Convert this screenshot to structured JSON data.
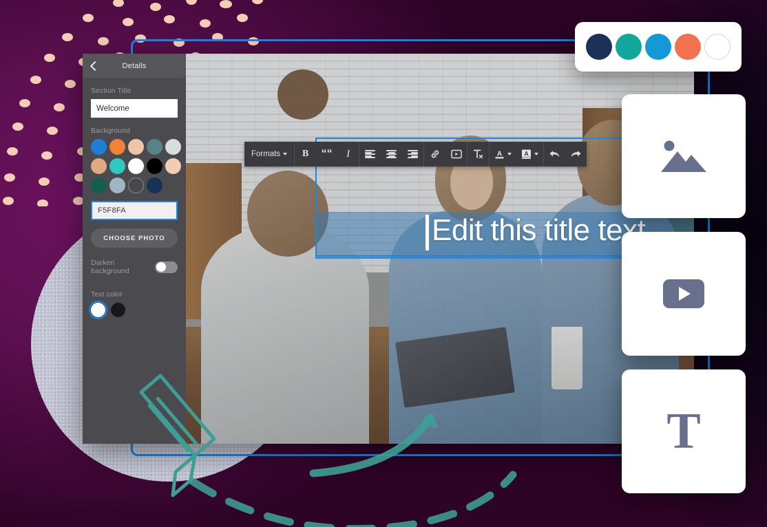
{
  "window": {
    "sidebar": {
      "header_title": "Details",
      "back_icon": "chevron-left-icon",
      "section_title_label": "Section Title",
      "section_title_value": "Welcome",
      "section_title_placeholder": "Section Title",
      "background_label": "Background",
      "background_swatches": [
        {
          "name": "blue",
          "hex": "#1f7fd6"
        },
        {
          "name": "orange",
          "hex": "#f28238"
        },
        {
          "name": "peach",
          "hex": "#efc4a8"
        },
        {
          "name": "teal-gray",
          "hex": "#548486"
        },
        {
          "name": "light-gray",
          "hex": "#d8dde0"
        },
        {
          "name": "tan",
          "hex": "#e0a97f"
        },
        {
          "name": "turquoise",
          "hex": "#2ec9c0"
        },
        {
          "name": "white",
          "hex": "#ffffff"
        },
        {
          "name": "black",
          "hex": "#000000"
        },
        {
          "name": "light-peach",
          "hex": "#f1cdb4"
        },
        {
          "name": "dark-green",
          "hex": "#11604f"
        },
        {
          "name": "blue-gray",
          "hex": "#9fb5c2"
        },
        {
          "name": "dark-gray",
          "hex": "#46474b"
        },
        {
          "name": "navy",
          "hex": "#163256"
        }
      ],
      "hex_value": "F5F8FA",
      "choose_photo_label": "CHOOSE PHOTO",
      "darken_background_label": "Darken background",
      "darken_background_on": false,
      "text_color_label": "Text color",
      "text_colors": [
        {
          "name": "white",
          "hex": "#ffffff",
          "selected": true
        },
        {
          "name": "black",
          "hex": "#16171a",
          "selected": false
        }
      ]
    },
    "canvas": {
      "title_text": "Edit this title text",
      "caret_visible": true,
      "selection_accent": "#1a86e8",
      "band_color": "#377ab2"
    },
    "toolbar": {
      "groups": [
        {
          "items": [
            {
              "name": "formats-dropdown",
              "label": "Formats",
              "icon": "chevron-down-icon"
            }
          ]
        },
        {
          "items": [
            {
              "name": "bold-button",
              "label": "B",
              "icon": "bold-icon"
            },
            {
              "name": "blockquote-button",
              "label": "“",
              "icon": "quote-icon"
            },
            {
              "name": "italic-button",
              "label": "I",
              "icon": "italic-icon"
            }
          ]
        },
        {
          "items": [
            {
              "name": "align-left-button",
              "label": "",
              "icon": "align-left-icon"
            },
            {
              "name": "align-center-button",
              "label": "",
              "icon": "align-center-icon"
            },
            {
              "name": "align-right-button",
              "label": "",
              "icon": "align-right-icon"
            }
          ]
        },
        {
          "items": [
            {
              "name": "insert-link-button",
              "label": "",
              "icon": "link-icon"
            },
            {
              "name": "insert-media-button",
              "label": "",
              "icon": "media-embed-icon"
            }
          ]
        },
        {
          "items": [
            {
              "name": "clear-formatting-button",
              "label": "",
              "icon": "clear-format-icon"
            }
          ]
        },
        {
          "items": [
            {
              "name": "text-color-button",
              "label": "A",
              "icon": "text-color-icon"
            },
            {
              "name": "highlight-color-button",
              "label": "A",
              "icon": "highlight-color-icon"
            }
          ]
        },
        {
          "items": [
            {
              "name": "undo-button",
              "label": "",
              "icon": "undo-arrow-icon"
            },
            {
              "name": "redo-button",
              "label": "",
              "icon": "redo-arrow-icon"
            }
          ]
        }
      ]
    }
  },
  "cards": {
    "palette": {
      "swatches": [
        {
          "name": "navy",
          "hex": "#1b3159",
          "ring": false
        },
        {
          "name": "teal",
          "hex": "#12a79a",
          "ring": false
        },
        {
          "name": "blue",
          "hex": "#139ad6",
          "ring": false
        },
        {
          "name": "coral",
          "hex": "#f2714f",
          "ring": false
        },
        {
          "name": "white",
          "hex": "#ffffff",
          "ring": true
        }
      ]
    },
    "image": {
      "icon": "photo-mountain-icon",
      "accent": "#69708e"
    },
    "video": {
      "icon": "play-button-icon",
      "accent": "#69708e"
    },
    "text": {
      "icon": "text-t-icon",
      "glyph": "T",
      "accent": "#69708e"
    }
  },
  "decorations": {
    "dot_color": "#f3cdb4",
    "blob_color": "#c7d0dc",
    "pencil_color": "#3e9e95",
    "arc_color": "#3e9e95",
    "background_color": "#52124a",
    "frame_color": "#1a86e8"
  }
}
